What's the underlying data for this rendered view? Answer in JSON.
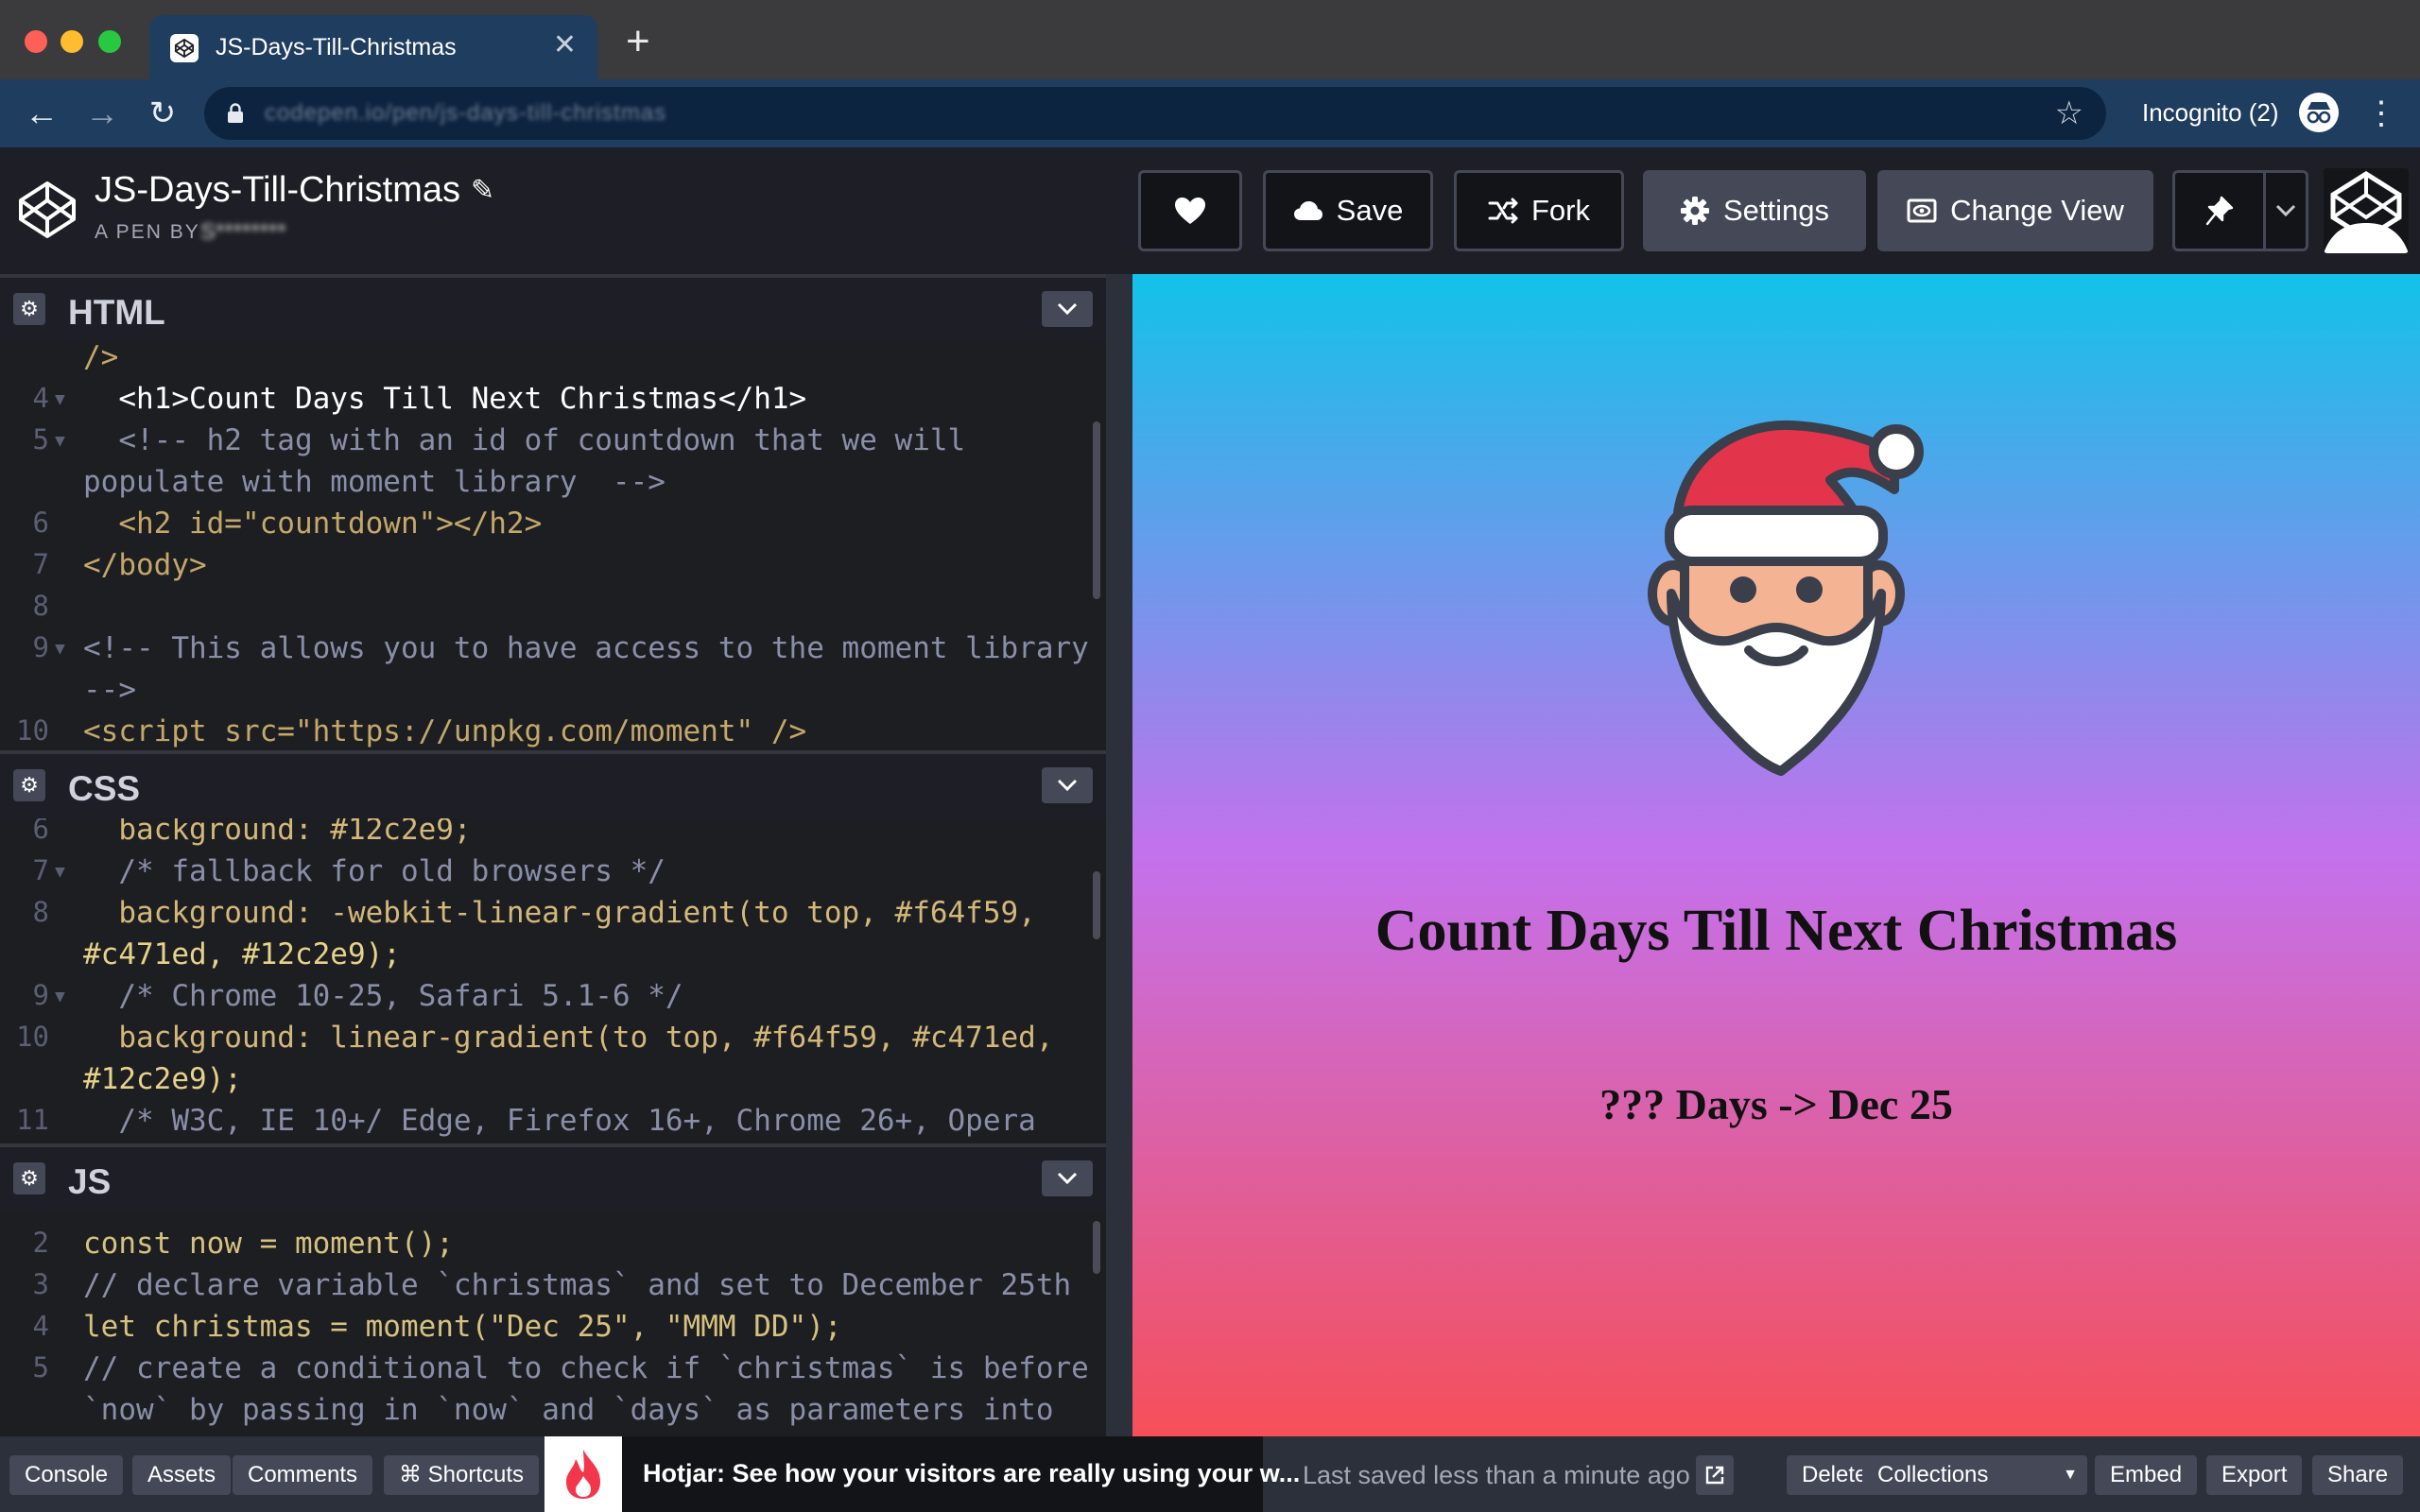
{
  "browser": {
    "tab_title": "JS-Days-Till-Christmas",
    "tab_close": "✕",
    "new_tab": "+",
    "url": "codepen.io/pen/js-days-till-christmas",
    "incognito_label": "Incognito (2)"
  },
  "header": {
    "pen_title": "JS-Days-Till-Christmas",
    "pen_by": "A PEN BY",
    "author": "S********",
    "save_label": "Save",
    "fork_label": "Fork",
    "settings_label": "Settings",
    "change_view_label": "Change View"
  },
  "panes": {
    "html_title": "HTML",
    "css_title": "CSS",
    "js_title": "JS"
  },
  "html_code": [
    {
      "ln": "",
      "text": "/>"
    },
    {
      "ln": "4",
      "text": "  <h1>Count Days Till Next Christmas</h1>"
    },
    {
      "ln": "5",
      "text": "  <!-- h2 tag with an id of countdown that we will"
    },
    {
      "ln": "",
      "text": "populate with moment library  -->"
    },
    {
      "ln": "6",
      "text": "  <h2 id=\"countdown\"></h2>"
    },
    {
      "ln": "7",
      "text": "</body>"
    },
    {
      "ln": "8",
      "text": ""
    },
    {
      "ln": "9",
      "text": "<!-- This allows you to have access to the moment library"
    },
    {
      "ln": "",
      "text": "-->"
    },
    {
      "ln": "10",
      "text": "<script src=\"https://unpkg.com/moment\" />"
    }
  ],
  "css_code": [
    {
      "ln": "6",
      "text": "  background: #12c2e9;"
    },
    {
      "ln": "7",
      "text": "  /* fallback for old browsers */"
    },
    {
      "ln": "8",
      "text": "  background: -webkit-linear-gradient(to top, #f64f59,"
    },
    {
      "ln": "",
      "text": "#c471ed, #12c2e9);"
    },
    {
      "ln": "9",
      "text": "  /* Chrome 10-25, Safari 5.1-6 */"
    },
    {
      "ln": "10",
      "text": "  background: linear-gradient(to top, #f64f59, #c471ed,"
    },
    {
      "ln": "",
      "text": "#12c2e9);"
    },
    {
      "ln": "11",
      "text": "  /* W3C, IE 10+/ Edge, Firefox 16+, Chrome 26+, Opera"
    }
  ],
  "js_code": [
    {
      "ln": "2",
      "text": "const now = moment();"
    },
    {
      "ln": "3",
      "text": "// declare variable `christmas` and set to December 25th"
    },
    {
      "ln": "4",
      "text": "let christmas = moment(\"Dec 25\", \"MMM DD\");"
    },
    {
      "ln": "5",
      "text": "// create a conditional to check if `christmas` is before"
    },
    {
      "ln": "",
      "text": "`now` by passing in `now` and `days` as parameters into"
    }
  ],
  "preview": {
    "heading": "Count Days Till Next Christmas",
    "countdown": "??? Days -> Dec 25",
    "gradient": [
      "#f64f59",
      "#c471ed",
      "#12c2e9"
    ]
  },
  "footer": {
    "console": "Console",
    "assets": "Assets",
    "comments": "Comments",
    "shortcuts": "⌘ Shortcuts",
    "hotjar_ad": "Hotjar: See how your visitors are really using your w...",
    "saved_status": "Last saved less than a minute ago",
    "delete": "Delete",
    "collections": "Collections",
    "embed": "Embed",
    "export": "Export",
    "share": "Share"
  },
  "icons": {
    "heart": "heart-icon",
    "cloud": "cloud-icon",
    "fork": "fork-icon",
    "gear": "gear-icon",
    "eye": "change-view-icon",
    "pin": "pin-icon",
    "santa": "santa-icon"
  }
}
